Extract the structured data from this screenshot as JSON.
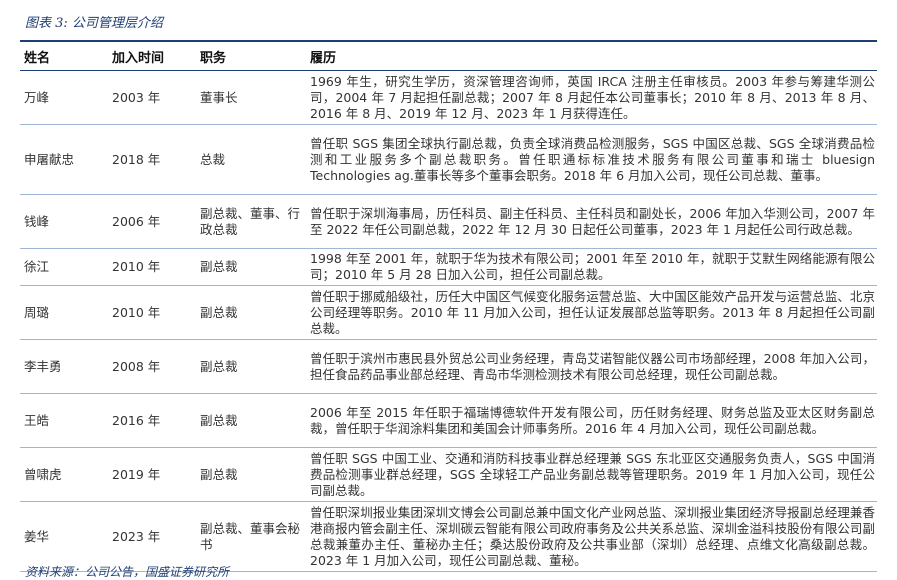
{
  "caption": "图表 3:  公司管理层介绍",
  "headers": [
    "姓名",
    "加入时间",
    "职务",
    "履历"
  ],
  "rows": [
    {
      "name": "万峰",
      "year": "2003 年",
      "title": "董事长",
      "bio": "1969 年生，研究生学历，资深管理咨询师，英国 IRCA 注册主任审核员。2003 年参与筹建华测公司，2004 年 7 月起担任副总裁；2007 年 8 月起任本公司董事长；2010 年 8 月、2013 年 8 月、2016 年 8 月、2019 年 12 月、2023 年 1 月获得连任。"
    },
    {
      "name": "申屠献忠",
      "year": "2018 年",
      "title": "总裁",
      "bio": "曾任职 SGS 集团全球执行副总裁，负责全球消费品检测服务，SGS 中国区总裁、SGS 全球消费品检测和工业服务多个副总裁职务。曾任职通标标准技术服务有限公司董事和瑞士 bluesign Technologies ag.董事长等多个董事会职务。2018 年 6 月加入公司，现任公司总裁、董事。"
    },
    {
      "name": "钱峰",
      "year": "2006 年",
      "title": "副总裁、董事、行政总裁",
      "bio": "曾任职于深圳海事局，历任科员、副主任科员、主任科员和副处长，2006 年加入华测公司，2007 年至 2022 年任公司副总裁，2022 年 12 月 30 日起任公司董事，2023 年 1 月起任公司行政总裁。"
    },
    {
      "name": "徐江",
      "year": "2010 年",
      "title": "副总裁",
      "bio": "1998 年至 2001 年，就职于华为技术有限公司；2001 年至 2010 年，就职于艾默生网络能源有限公司；2010 年 5 月 28 日加入公司，担任公司副总裁。"
    },
    {
      "name": "周璐",
      "year": "2010 年",
      "title": "副总裁",
      "bio": "曾任职于挪威船级社，历任大中国区气候变化服务运营总监、大中国区能效产品开发与运营总监、北京公司经理等职务。2010 年 11 月加入公司，担任认证发展部总监等职务。2013 年 8 月起担任公司副总裁。"
    },
    {
      "name": "李丰勇",
      "year": "2008 年",
      "title": "副总裁",
      "bio": "曾任职于滨州市惠民县外贸总公司业务经理，青岛艾诺智能仪器公司市场部经理，2008 年加入公司，担任食品药品事业部总经理、青岛市华测检测技术有限公司总经理，现任公司副总裁。"
    },
    {
      "name": "王皓",
      "year": "2016 年",
      "title": "副总裁",
      "bio": "2006 年至 2015 年任职于福瑞博德软件开发有限公司，历任财务经理、财务总监及亚太区财务副总裁，曾任职于华润涂料集团和美国会计师事务所。2016 年 4 月加入公司，现任公司副总裁。"
    },
    {
      "name": "曾啸虎",
      "year": "2019 年",
      "title": "副总裁",
      "bio": "曾任职 SGS 中国工业、交通和消防科技事业群总经理兼 SGS 东北亚区交通服务负责人，SGS 中国消费品检测事业群总经理，SGS 全球轻工产品业务副总裁等管理职务。2019 年 1 月加入公司，现任公司副总裁。"
    },
    {
      "name": "姜华",
      "year": "2023 年",
      "title": "副总裁、董事会秘书",
      "bio": "曾任职深圳报业集团深圳文博会公司副总兼中国文化产业网总监、深圳报业集团经济导报副总经理兼香港商报内管会副主任、深圳碳云智能有限公司政府事务及公共关系总监、深圳金溢科技股份有限公司副总裁兼董办主任、董秘办主任；桑达股份政府及公共事业部（深圳）总经理、点维文化高级副总裁。2023 年 1 月加入公司，现任公司副总裁、董秘。"
    }
  ],
  "footer": "资料来源：公司公告，国盛证券研究所"
}
